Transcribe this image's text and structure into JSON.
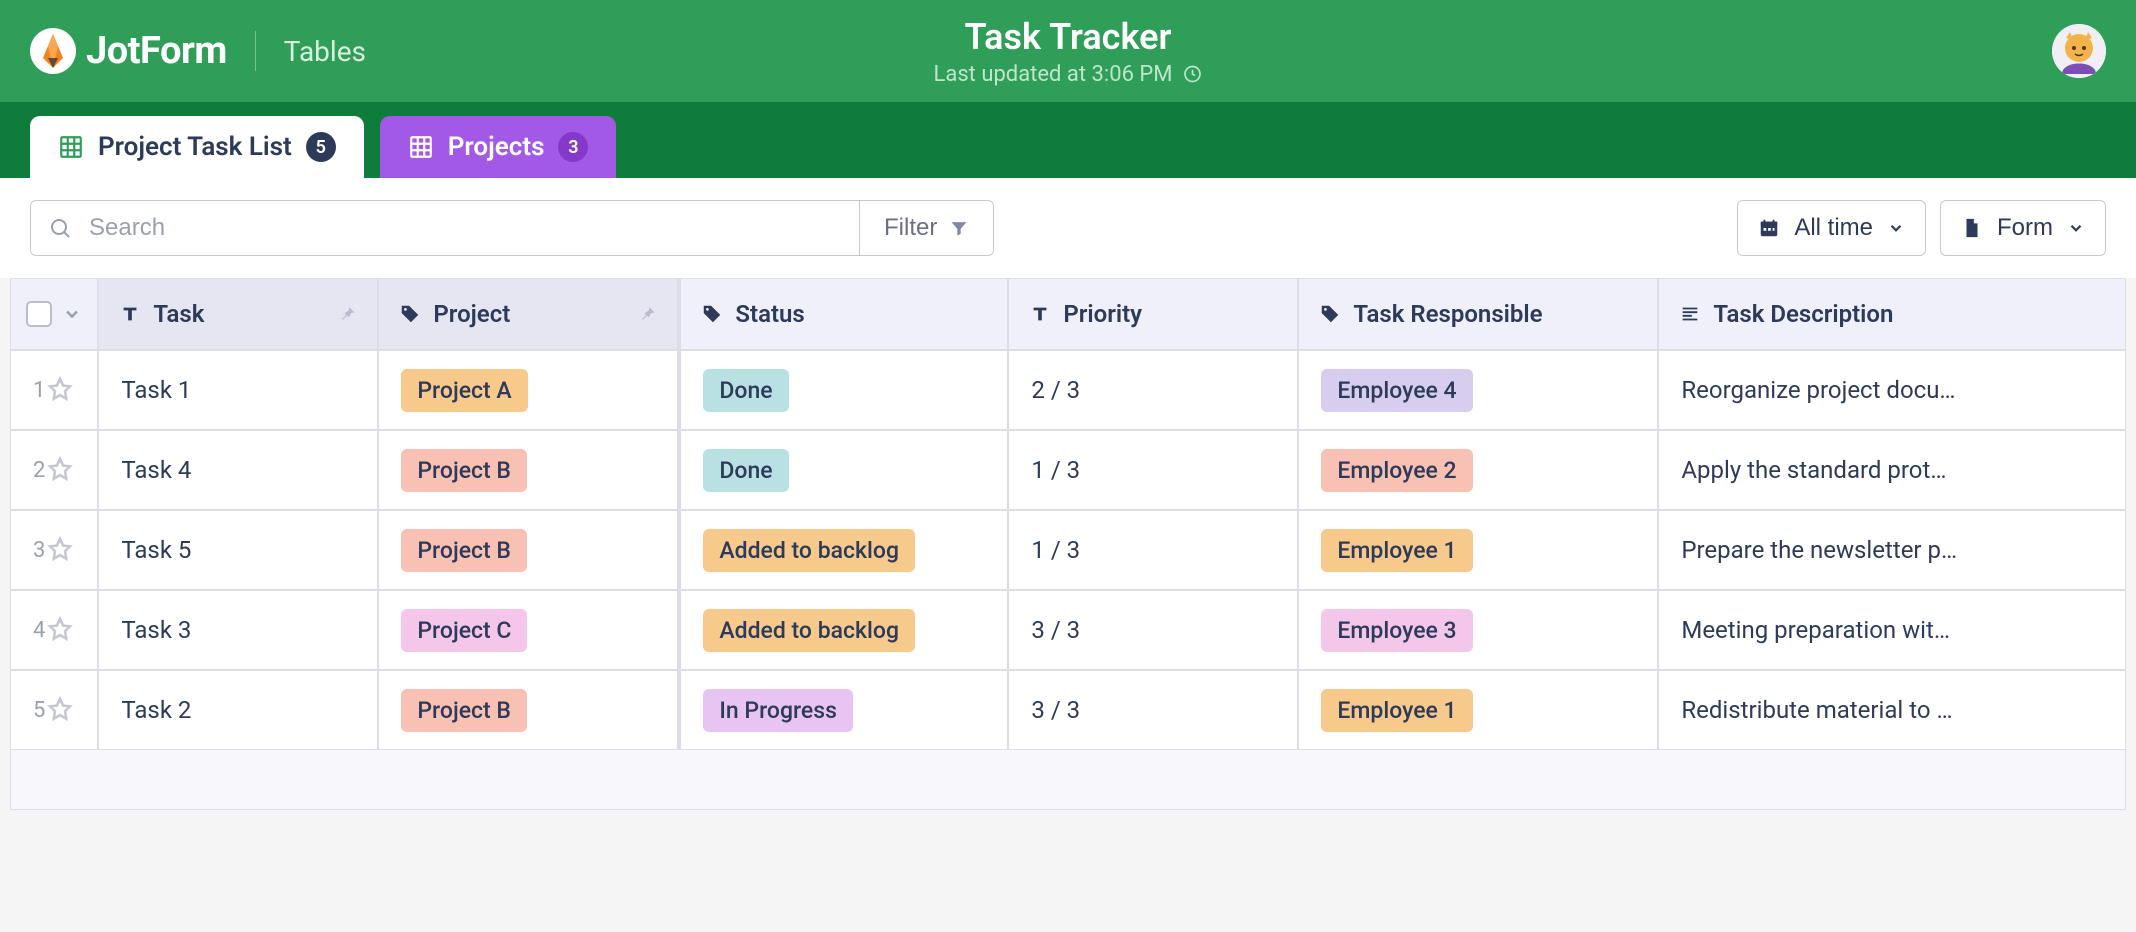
{
  "brand": {
    "name": "JotForm",
    "product": "Tables"
  },
  "page": {
    "title": "Task Tracker",
    "subtitle": "Last updated at 3:06 PM"
  },
  "tabs": [
    {
      "label": "Project Task List",
      "count": "5",
      "active": true
    },
    {
      "label": "Projects",
      "count": "3",
      "active": false
    }
  ],
  "toolbar": {
    "search_placeholder": "Search",
    "filter_label": "Filter",
    "time_label": "All time",
    "form_label": "Form"
  },
  "columns": {
    "task": "Task",
    "project": "Project",
    "status": "Status",
    "priority": "Priority",
    "responsible": "Task Responsible",
    "description": "Task Description"
  },
  "chip_colors": {
    "Project A": "#f7c98b",
    "Project B": "#f8c1b4",
    "Project C": "#f3c6ea",
    "Done": "#b9e0e3",
    "Added to backlog": "#f7c98b",
    "In Progress": "#e7c4f2",
    "Employee 1": "#f7c98b",
    "Employee 2": "#f8c1b4",
    "Employee 3": "#f3c6ea",
    "Employee 4": "#d7ceef"
  },
  "rows": [
    {
      "num": "1",
      "task": "Task 1",
      "project": "Project A",
      "status": "Done",
      "priority": "2 / 3",
      "responsible": "Employee 4",
      "description": "Reorganize project docu…"
    },
    {
      "num": "2",
      "task": "Task 4",
      "project": "Project B",
      "status": "Done",
      "priority": "1 / 3",
      "responsible": "Employee 2",
      "description": "Apply the standard prot…"
    },
    {
      "num": "3",
      "task": "Task 5",
      "project": "Project B",
      "status": "Added to backlog",
      "priority": "1 / 3",
      "responsible": "Employee 1",
      "description": "Prepare the newsletter p…"
    },
    {
      "num": "4",
      "task": "Task 3",
      "project": "Project C",
      "status": "Added to backlog",
      "priority": "3 / 3",
      "responsible": "Employee 3",
      "description": "Meeting preparation wit…"
    },
    {
      "num": "5",
      "task": "Task 2",
      "project": "Project B",
      "status": "In Progress",
      "priority": "3 / 3",
      "responsible": "Employee 1",
      "description": "Redistribute material to …"
    }
  ]
}
